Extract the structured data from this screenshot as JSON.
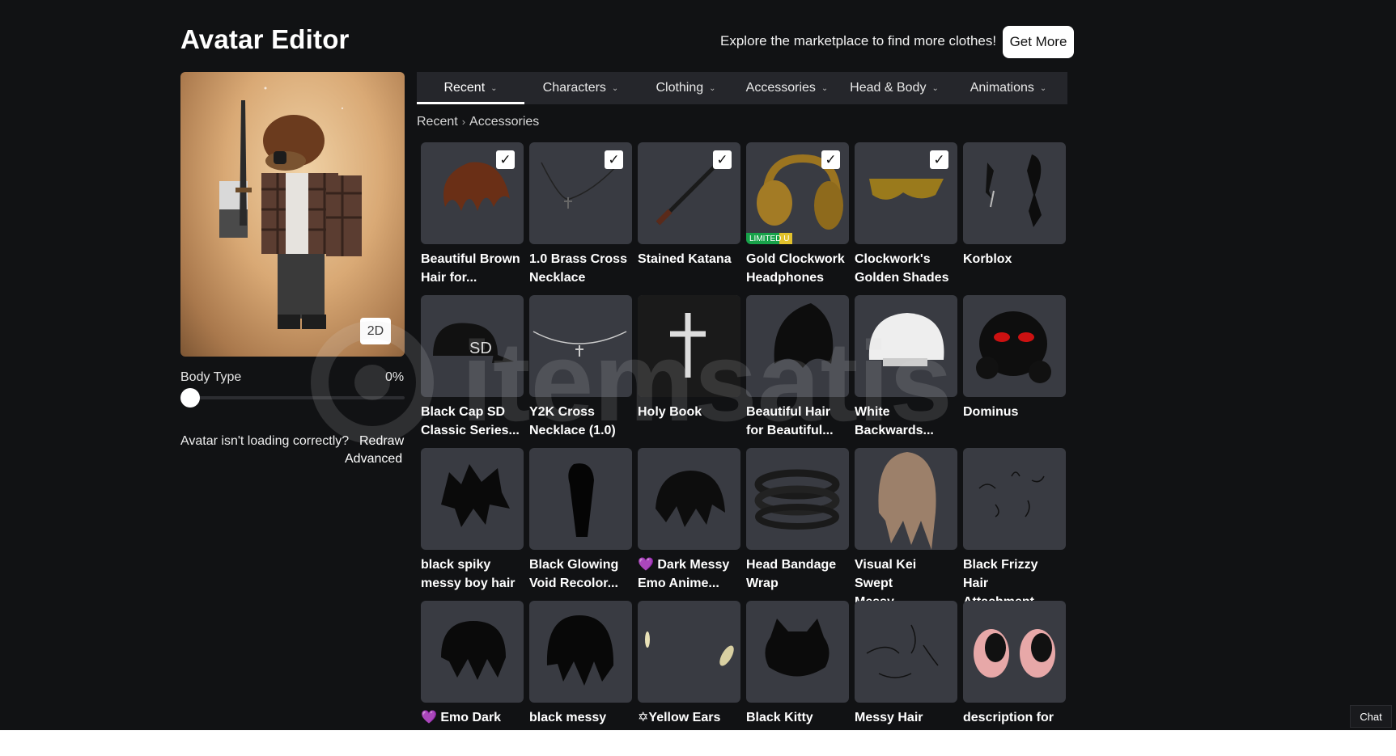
{
  "header": {
    "title": "Avatar Editor",
    "promo_text": "Explore the marketplace to find more clothes!",
    "get_more_label": "Get More"
  },
  "preview": {
    "toggle_label": "2D",
    "body_type_label": "Body Type",
    "body_type_value": "0%",
    "body_type_fraction": 0,
    "loading_message": "Avatar isn't loading correctly?",
    "redraw_label": "Redraw",
    "advanced_label": "Advanced"
  },
  "tabs": [
    {
      "label": "Recent",
      "active": true
    },
    {
      "label": "Characters",
      "active": false
    },
    {
      "label": "Clothing",
      "active": false
    },
    {
      "label": "Accessories",
      "active": false
    },
    {
      "label": "Head & Body",
      "active": false
    },
    {
      "label": "Animations",
      "active": false
    }
  ],
  "breadcrumb": [
    "Recent",
    "Accessories"
  ],
  "items": [
    {
      "line1": "Beautiful Brown",
      "line2": "Hair for...",
      "checked": true,
      "icon": "brown-hair-icon"
    },
    {
      "line1": "1.0 Brass Cross",
      "line2": "Necklace",
      "checked": true,
      "icon": "cross-necklace-icon"
    },
    {
      "line1": "Stained Katana",
      "line2": "",
      "checked": true,
      "icon": "katana-icon"
    },
    {
      "line1": "Gold Clockwork",
      "line2": "Headphones",
      "checked": true,
      "icon": "headphones-icon",
      "badge": "LIMITED U"
    },
    {
      "line1": "Clockwork's",
      "line2": "Golden Shades",
      "checked": true,
      "icon": "shades-icon"
    },
    {
      "line1": "Korblox",
      "line2": "",
      "checked": false,
      "icon": "korblox-icon"
    },
    {
      "line1": "Black Cap SD",
      "line2": "Classic Series...",
      "checked": false,
      "icon": "cap-icon"
    },
    {
      "line1": "Y2K Cross",
      "line2": "Necklace (1.0)",
      "checked": false,
      "icon": "y2k-necklace-icon"
    },
    {
      "line1": "Holy Book",
      "line2": "",
      "checked": false,
      "icon": "holy-book-icon"
    },
    {
      "line1": "Beautiful Hair",
      "line2": "for Beautiful...",
      "checked": false,
      "icon": "black-hair-icon"
    },
    {
      "line1": "White",
      "line2": "Backwards...",
      "checked": false,
      "icon": "white-cap-icon"
    },
    {
      "line1": "Dominus",
      "line2": "",
      "checked": false,
      "icon": "dominus-icon"
    },
    {
      "line1": "black spiky",
      "line2": "messy boy hair",
      "checked": false,
      "icon": "spiky-hair-icon"
    },
    {
      "line1": "Black Glowing",
      "line2": "Void Recolor...",
      "checked": false,
      "icon": "void-icon"
    },
    {
      "line1": "💜 Dark Messy",
      "line2": "Emo Anime...",
      "checked": false,
      "icon": "messy-hair-icon"
    },
    {
      "line1": "Head Bandage",
      "line2": "Wrap",
      "checked": false,
      "icon": "bandage-icon"
    },
    {
      "line1": "Visual Kei Swept",
      "line2": "Messy Guitarist'...",
      "checked": false,
      "icon": "swept-hair-icon"
    },
    {
      "line1": "Black Frizzy Hair",
      "line2": "Attachment",
      "checked": false,
      "icon": "frizzy-hair-icon"
    },
    {
      "line1": "💜 Emo Dark",
      "line2": "",
      "checked": false,
      "icon": "emo-hair-icon"
    },
    {
      "line1": "black messy",
      "line2": "",
      "checked": false,
      "icon": "black-messy-hair-icon"
    },
    {
      "line1": "✡Yellow Ears",
      "line2": "",
      "checked": false,
      "icon": "yellow-ears-icon"
    },
    {
      "line1": "Black Kitty Beret",
      "line2": "",
      "checked": false,
      "icon": "kitty-beret-icon"
    },
    {
      "line1": "Messy Hair",
      "line2": "",
      "checked": false,
      "icon": "messy-strands-icon"
    },
    {
      "line1": "description for",
      "line2": "",
      "checked": false,
      "icon": "eyes-icon"
    }
  ],
  "watermark_text": "itemsatis",
  "chat_label": "Chat"
}
